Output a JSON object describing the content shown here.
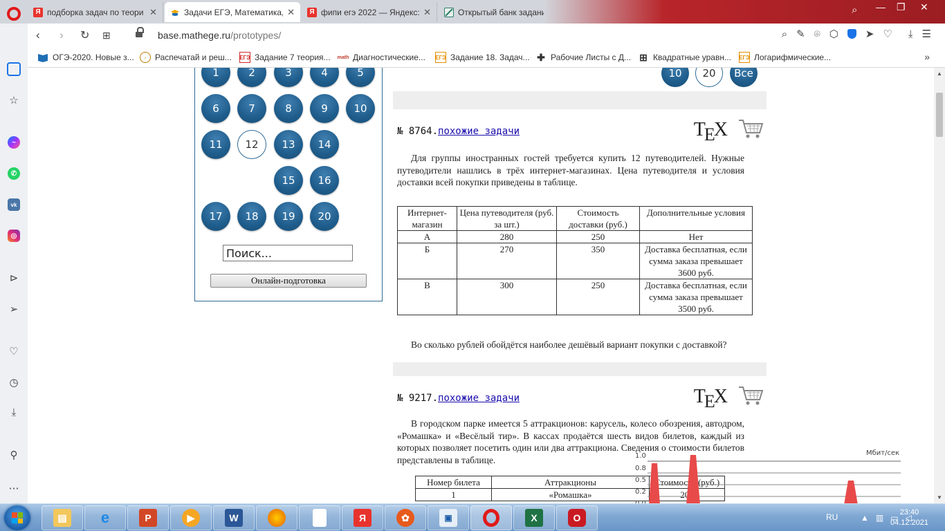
{
  "browser": {
    "tabs": [
      {
        "title": "подборка задач по теори",
        "icon": "yandex",
        "icon_letter": "Я",
        "icon_color": "#e8332d"
      },
      {
        "title": "Задачи ЕГЭ, Математика, ",
        "icon": "education",
        "icon_letter": "",
        "icon_color": "#f0a800",
        "active": true
      },
      {
        "title": "фипи егэ 2022 — Яндекс: ",
        "icon": "yandex",
        "icon_letter": "Я",
        "icon_color": "#e8332d"
      },
      {
        "title": "Открытый банк заданий Е",
        "icon": "fipi",
        "icon_letter": "",
        "icon_color": "#2e7d6b"
      }
    ],
    "url_host": "base.mathege.ru",
    "url_path": "/prototypes/",
    "bookmarks": [
      {
        "label": "ОГЭ-2020. Новые з...",
        "icon": "book-icon"
      },
      {
        "label": "Распечатай и реш...",
        "icon": "compass-icon"
      },
      {
        "label": "Задание 7 теория...",
        "icon": "ege-icon"
      },
      {
        "label": "Диагностические...",
        "icon": "math-icon"
      },
      {
        "label": "Задание 18. Задач...",
        "icon": "ege-icon"
      },
      {
        "label": "Рабочие Листы с Д...",
        "icon": "puzzle-icon"
      },
      {
        "label": "Квадратные уравн...",
        "icon": "grid-icon"
      },
      {
        "label": "Логарифмические...",
        "icon": "ege-icon"
      }
    ]
  },
  "panel": {
    "numbers": [
      "1",
      "2",
      "3",
      "4",
      "5",
      "6",
      "7",
      "8",
      "9",
      "10",
      "11",
      "12",
      "13",
      "14",
      "15",
      "16",
      "17",
      "18",
      "19",
      "20"
    ],
    "selected": "12",
    "search_placeholder": "Поиск...",
    "online_label": "Онлайн-подготовка"
  },
  "pager": {
    "items": [
      "10",
      "20",
      "Все"
    ],
    "selected": "20"
  },
  "tasks": [
    {
      "number_label": "№ 8764.",
      "similar_link": "похожие задачи",
      "tex_label": "TEX",
      "intro": "Для группы иностранных гостей требуется купить 12 путеводителей. Нужные путеводители нашлись в трёх интернет-магазинах. Цена путеводителя и условия доставки всей покупки приведены в таблице.",
      "table": {
        "headers": [
          "Интернет-магазин",
          "Цена путеводителя (руб. за шт.)",
          "Стоимость доставки (руб.)",
          "Дополнительные условия"
        ],
        "rows": [
          [
            "А",
            "280",
            "250",
            "Нет"
          ],
          [
            "Б",
            "270",
            "350",
            "Доставка бесплатная, если сумма заказа превышает 3600 руб."
          ],
          [
            "В",
            "300",
            "250",
            "Доставка бесплатная, если сумма заказа превышает 3500 руб."
          ]
        ]
      },
      "question": "Во сколько рублей обойдётся наиболее дешёвый вариант покупки с доставкой?"
    },
    {
      "number_label": "№ 9217.",
      "similar_link": "похожие задачи",
      "tex_label": "TEX",
      "intro": "В городском парке имеется 5 аттракционов: карусель, колесо обозрения, автодром, «Ромашка» и «Весёлый тир». В кассах продаётся шесть видов билетов, каждый из которых позволяет посетить один или два аттракциона. Сведения о стоимости билетов представлены в таблице.",
      "table": {
        "headers": [
          "Номер билета",
          "Аттракционы",
          "Стоимость (руб.)"
        ],
        "rows": [
          [
            "1",
            "«Ромашка»",
            "200"
          ]
        ]
      }
    }
  ],
  "net_widget": {
    "unit": "Мбит/сек",
    "ticks": [
      "1.0",
      "0.8",
      "0.5",
      "0.2",
      "0.0"
    ],
    "bar_color": "#e84a4a"
  },
  "taskbar": {
    "apps": [
      "explorer",
      "ie",
      "powerpoint",
      "media",
      "word",
      "firefox",
      "file",
      "yandex",
      "bittorrent",
      "scanner",
      "opera",
      "excel",
      "opera-gx"
    ],
    "lang": "RU",
    "time": "23:40",
    "date": "04.12.2021"
  }
}
